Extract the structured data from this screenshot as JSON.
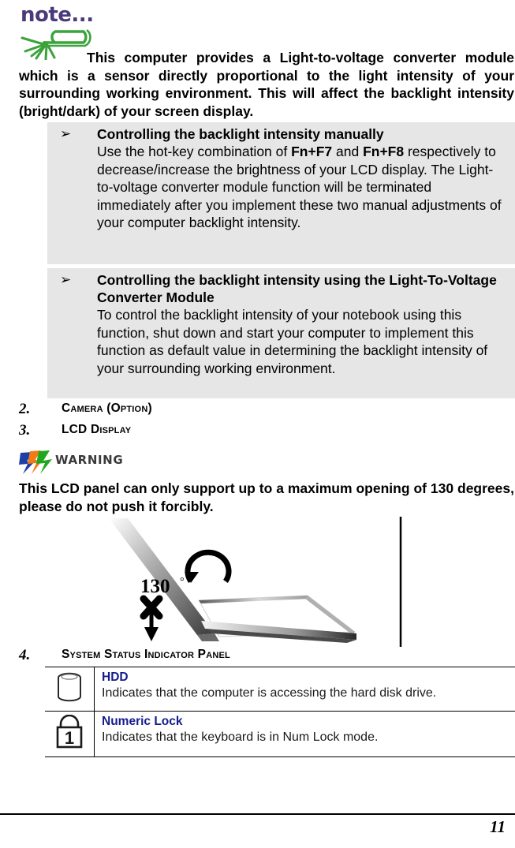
{
  "note": {
    "icon_label": "note...",
    "icon_name": "note-paperclip-icon",
    "paragraph_lead_text": "This computer provides a Light-to-voltage converter module which is a sensor directly proportional to the light intensity of your surrounding working environment. This will affect the backlight intensity (bright/dark) of your screen display."
  },
  "callouts": [
    {
      "bullet": "➢",
      "title": "Controlling the backlight intensity manually",
      "body_pre": "Use the hot-key combination of ",
      "key1": "Fn+F7",
      "body_mid": " and ",
      "key2": "Fn+F8",
      "body_post": " respectively to decrease/increase the brightness of your LCD display. The Light-to-voltage converter module function will be terminated immediately after you implement these two manual adjustments of your computer backlight intensity."
    },
    {
      "bullet": "➢",
      "title": "Controlling the backlight intensity using the Light-To-Voltage Converter Module",
      "body": "To control the backlight intensity of your notebook using this function, shut down and start your computer to implement this function as default value in determining the backlight intensity of your surrounding working environment."
    }
  ],
  "headings": [
    {
      "number": "2.",
      "text": "Camera (Option)"
    },
    {
      "number": "3.",
      "text": "LCD Display"
    },
    {
      "number": "4.",
      "text": "System Status Indicator Panel"
    }
  ],
  "warning": {
    "label": "WARNING",
    "icon_name": "lightning-bolts-icon",
    "text": "This LCD panel can only support up to a maximum opening of 130 degrees, please do not push it forcibly."
  },
  "illustration": {
    "name": "laptop-lid-opening-angle-diagram",
    "angle_label": "130",
    "degree_symbol": "°",
    "marks": [
      "x-mark",
      "down-arrow",
      "rotation-arrow"
    ]
  },
  "status_table": {
    "rows": [
      {
        "icon_name": "hard-disk-drive-icon",
        "title": "HDD",
        "description": "Indicates that the computer is accessing the hard disk drive."
      },
      {
        "icon_name": "numeric-lock-padlock-icon",
        "icon_digit": "1",
        "title": "Numeric Lock",
        "description": "Indicates that the keyboard is in Num Lock mode."
      }
    ]
  },
  "footer": {
    "page_number": "11"
  },
  "colors": {
    "note_purple": "#4a3a7a",
    "note_green": "#3aa33a",
    "callout_gray": "#e6e6e6",
    "status_title_blue": "#141c8c",
    "bolt_blue": "#1f3fa8",
    "bolt_orange": "#f07c16",
    "bolt_green": "#1fa81f"
  }
}
